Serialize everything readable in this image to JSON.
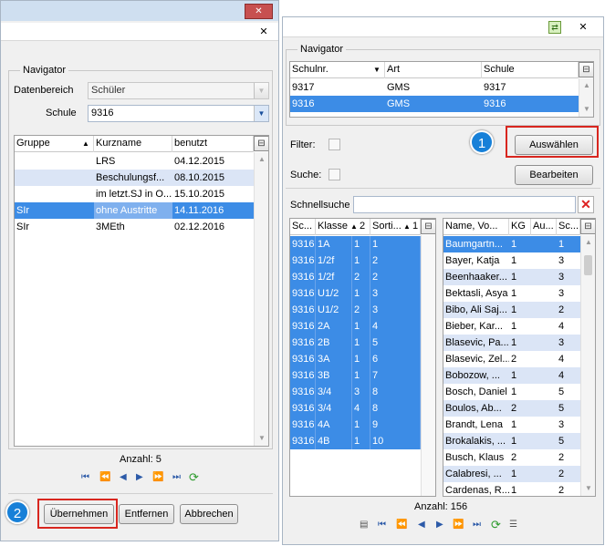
{
  "left": {
    "close_icon": "✕",
    "navigator_legend": "Navigator",
    "datenbereich_label": "Datenbereich",
    "datenbereich_value": "Schüler",
    "schule_label": "Schule",
    "schule_value": "9316",
    "columns": [
      "Gruppe",
      "Kurzname",
      "benutzt"
    ],
    "rows": [
      [
        "",
        "LRS",
        "04.12.2015"
      ],
      [
        "",
        "Beschulungsf...",
        "08.10.2015"
      ],
      [
        "",
        "im letzt.SJ in O...",
        "15.10.2015"
      ],
      [
        "SIr",
        "ohne Austritte",
        "14.11.2016"
      ],
      [
        "SIr",
        "3MEth",
        "02.12.2016"
      ]
    ],
    "anzahl": "Anzahl: 5",
    "buttons": {
      "uebernehmen": "Übernehmen",
      "entfernen": "Entfernen",
      "abbrechen": "Abbrechen"
    },
    "badge": "2"
  },
  "right": {
    "close_icon": "✕",
    "navigator_legend": "Navigator",
    "school_columns": [
      "Schulnr.",
      "Art",
      "Schule"
    ],
    "school_rows": [
      [
        "9317",
        "GMS",
        "9317"
      ],
      [
        "9316",
        "GMS",
        "9316"
      ]
    ],
    "filter_label": "Filter:",
    "suche_label": "Suche:",
    "auswaehlen": "Auswählen",
    "bearbeiten": "Bearbeiten",
    "badge": "1",
    "schnellsuche_label": "Schnellsuche",
    "schnellsuche_value": "",
    "class_columns": [
      "Sc...",
      "Klasse",
      "2",
      "Sorti...",
      "1"
    ],
    "class_rows": [
      [
        "9316",
        "1A",
        "1",
        "1"
      ],
      [
        "9316",
        "1/2f",
        "1",
        "2"
      ],
      [
        "9316",
        "1/2f",
        "2",
        "2"
      ],
      [
        "9316",
        "U1/2",
        "1",
        "3"
      ],
      [
        "9316",
        "U1/2",
        "2",
        "3"
      ],
      [
        "9316",
        "2A",
        "1",
        "4"
      ],
      [
        "9316",
        "2B",
        "1",
        "5"
      ],
      [
        "9316",
        "3A",
        "1",
        "6"
      ],
      [
        "9316",
        "3B",
        "1",
        "7"
      ],
      [
        "9316",
        "3/4",
        "3",
        "8"
      ],
      [
        "9316",
        "3/4",
        "4",
        "8"
      ],
      [
        "9316",
        "4A",
        "1",
        "9"
      ],
      [
        "9316",
        "4B",
        "1",
        "10"
      ]
    ],
    "student_columns": [
      "Name, Vo...",
      "KG",
      "Au...",
      "Sc..."
    ],
    "student_rows": [
      [
        "Baumgartn...",
        "1",
        "",
        "1"
      ],
      [
        "Bayer, Katja",
        "1",
        "",
        "3"
      ],
      [
        "Beenhaaker...",
        "1",
        "",
        "3"
      ],
      [
        "Bektasli, Asya",
        "1",
        "",
        "3"
      ],
      [
        "Bibo, Ali Saj...",
        "1",
        "",
        "2"
      ],
      [
        "Bieber, Kar...",
        "1",
        "",
        "4"
      ],
      [
        "Blasevic, Pa...",
        "1",
        "",
        "3"
      ],
      [
        "Blasevic, Zel...",
        "2",
        "",
        "4"
      ],
      [
        "Bobozow, ...",
        "1",
        "",
        "4"
      ],
      [
        "Bosch, Daniel",
        "1",
        "",
        "5"
      ],
      [
        "Boulos, Ab...",
        "2",
        "",
        "5"
      ],
      [
        "Brandt, Lena",
        "1",
        "",
        "3"
      ],
      [
        "Brokalakis, ...",
        "1",
        "",
        "5"
      ],
      [
        "Busch, Klaus",
        "2",
        "",
        "2"
      ],
      [
        "Calabresi, ...",
        "1",
        "",
        "2"
      ],
      [
        "Cardenas, R...",
        "1",
        "",
        "2"
      ]
    ],
    "anzahl": "Anzahl: 156"
  }
}
